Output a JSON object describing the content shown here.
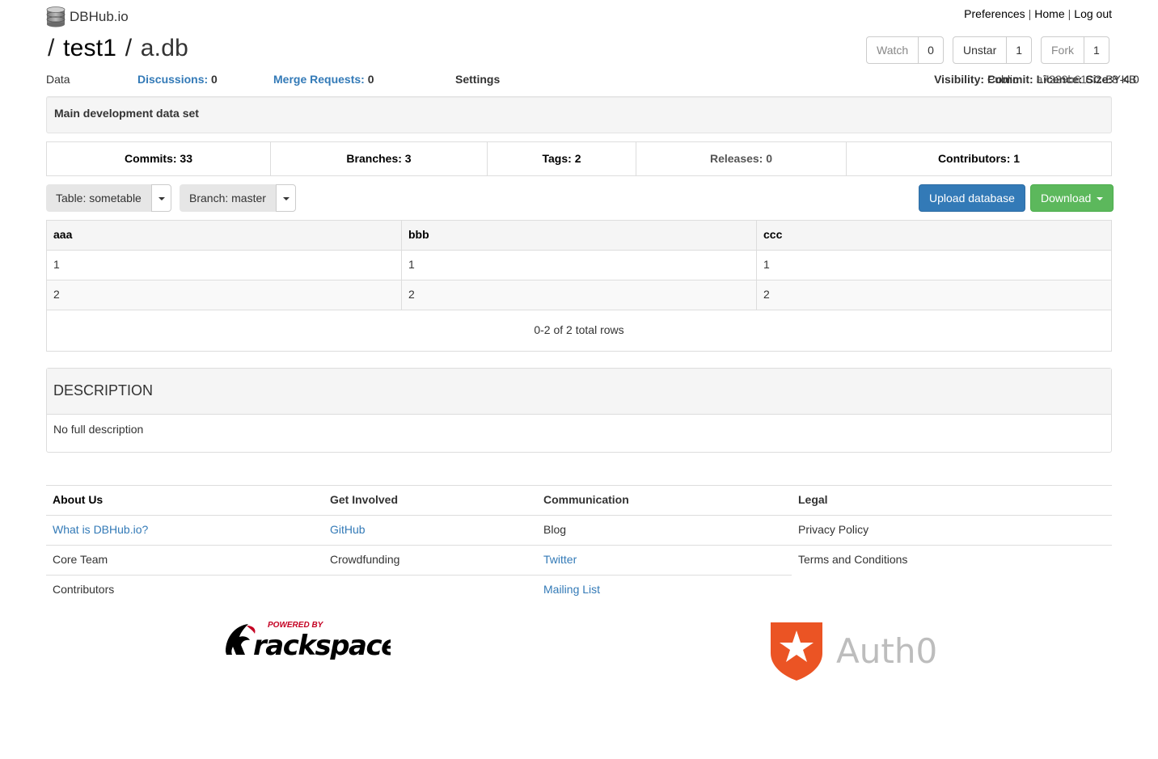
{
  "brand": {
    "name": "DBHub.io",
    "icon": "database-icon"
  },
  "top_nav": {
    "preferences": "Preferences",
    "home": "Home",
    "logout": "Log out",
    "separator": "|"
  },
  "title": {
    "slash": "/",
    "owner": "test1",
    "database": "a.db"
  },
  "social": {
    "watch": {
      "label": "Watch",
      "count": "0"
    },
    "star": {
      "label": "Unstar",
      "count": "1"
    },
    "fork": {
      "label": "Fork",
      "count": "1"
    }
  },
  "tabs": {
    "data": "Data",
    "discussions_label": "Discussions:",
    "discussions_count": "0",
    "merge_label": "Merge Requests:",
    "merge_count": "0",
    "settings": "Settings"
  },
  "meta": {
    "visibility_label": "Visibility:",
    "visibility_value": "Public",
    "commit_label": "Commit:",
    "commit_value": "a7229b61",
    "licence_label": "Licence:",
    "licence_value": "CC-BY-4.0",
    "size_label": "Size:",
    "size_value": "8 KB"
  },
  "one_line_description": "Main development data set",
  "stats": {
    "commits": "Commits: 33",
    "branches": "Branches: 3",
    "tags": "Tags: 2",
    "releases": "Releases: 0",
    "contributors": "Contributors: 1"
  },
  "selectors": {
    "table": "Table: sometable",
    "branch": "Branch: master"
  },
  "actions": {
    "upload": "Upload database",
    "download": "Download"
  },
  "table": {
    "columns": [
      "aaa",
      "bbb",
      "ccc"
    ],
    "rows": [
      [
        "1",
        "1",
        "1"
      ],
      [
        "2",
        "2",
        "2"
      ]
    ],
    "footer": "0-2 of 2 total rows"
  },
  "description": {
    "heading": "DESCRIPTION",
    "body": "No full description"
  },
  "footer": {
    "headers": [
      "About Us",
      "Get Involved",
      "Communication",
      "Legal"
    ],
    "about": [
      "What is DBHub.io?",
      "Core Team",
      "Contributors"
    ],
    "involved": [
      "GitHub",
      "Crowdfunding"
    ],
    "communication": [
      "Blog",
      "Twitter",
      "Mailing List"
    ],
    "legal": [
      "Privacy Policy",
      "Terms and Conditions"
    ]
  },
  "logos": {
    "rackspace": {
      "tagline": "POWERED BY",
      "name": "rackspace",
      "icon": "rackspace-logo"
    },
    "auth0": {
      "name": "Auth0",
      "icon": "auth0-logo"
    }
  },
  "colors": {
    "primary": "#337ab7",
    "success": "#5cb85c",
    "auth0_orange": "#eb5424",
    "rackspace_red": "#c40022"
  }
}
